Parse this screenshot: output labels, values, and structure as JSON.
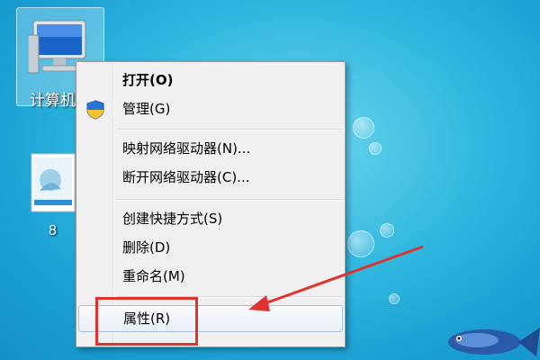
{
  "desktop": {
    "computer_icon_label": "计算机",
    "file_icon_label": "8"
  },
  "context_menu": {
    "items": [
      {
        "label": "打开(O)",
        "bold": true
      },
      {
        "label": "管理(G)",
        "icon": "uac-shield-icon"
      },
      {
        "label": "映射网络驱动器(N)..."
      },
      {
        "label": "断开网络驱动器(C)..."
      },
      {
        "label": "创建快捷方式(S)"
      },
      {
        "label": "删除(D)"
      },
      {
        "label": "重命名(M)"
      },
      {
        "label": "属性(R)",
        "highlighted": true
      }
    ]
  },
  "annotation": {
    "highlight_color": "#e0332f",
    "arrow_color": "#e0332f"
  }
}
